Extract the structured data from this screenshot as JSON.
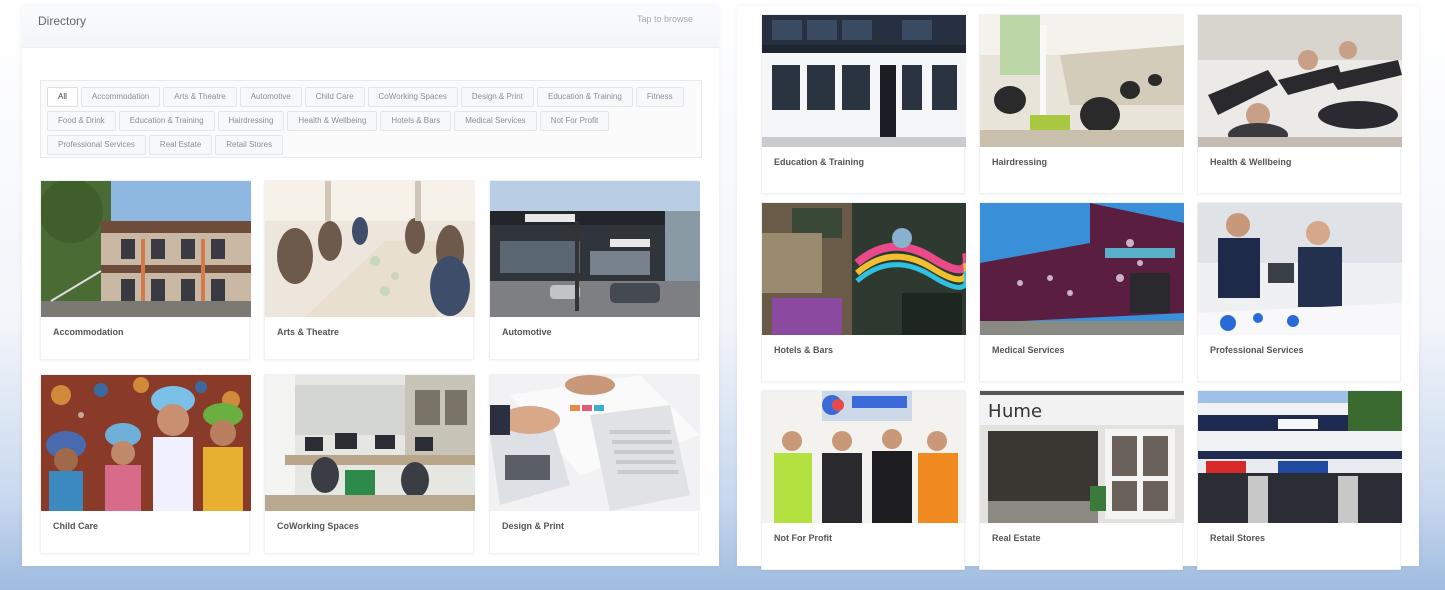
{
  "header": {
    "title": "Directory",
    "link": "Tap to browse"
  },
  "filters": [
    {
      "label": "All",
      "active": true
    },
    {
      "label": "Accommodation"
    },
    {
      "label": "Arts & Theatre"
    },
    {
      "label": "Automotive"
    },
    {
      "label": "Child Care"
    },
    {
      "label": "CoWorking Spaces"
    },
    {
      "label": "Design & Print"
    },
    {
      "label": "Education & Training"
    },
    {
      "label": "Fitness"
    },
    {
      "label": "Food & Drink"
    },
    {
      "label": "Education & Training"
    },
    {
      "label": "Hairdressing"
    },
    {
      "label": "Health & Wellbeing"
    },
    {
      "label": "Hotels & Bars"
    },
    {
      "label": "Medical Services"
    },
    {
      "label": "Not For Profit"
    },
    {
      "label": "Professional Services"
    },
    {
      "label": "Real Estate"
    },
    {
      "label": "Retail Stores"
    }
  ],
  "left_cards": [
    {
      "label": "Accommodation",
      "icon": "photo-motel"
    },
    {
      "label": "Arts & Theatre",
      "icon": "photo-workshop"
    },
    {
      "label": "Automotive",
      "icon": "photo-car-dealer"
    },
    {
      "label": "Child Care",
      "icon": "photo-children"
    },
    {
      "label": "CoWorking Spaces",
      "icon": "photo-office"
    },
    {
      "label": "Design & Print",
      "icon": "photo-keyboard"
    }
  ],
  "right_cards": [
    {
      "label": "Education & Training",
      "icon": "photo-building"
    },
    {
      "label": "Hairdressing",
      "icon": "photo-salon"
    },
    {
      "label": "Health & Wellbeing",
      "icon": "photo-fitness"
    },
    {
      "label": "Hotels & Bars",
      "icon": "photo-bar"
    },
    {
      "label": "Medical Services",
      "icon": "photo-medical-building"
    },
    {
      "label": "Professional Services",
      "icon": "photo-meeting"
    },
    {
      "label": "Not For Profit",
      "icon": "photo-volunteers"
    },
    {
      "label": "Real Estate",
      "icon": "photo-shopfront"
    },
    {
      "label": "Retail Stores",
      "icon": "photo-retail-street"
    }
  ]
}
